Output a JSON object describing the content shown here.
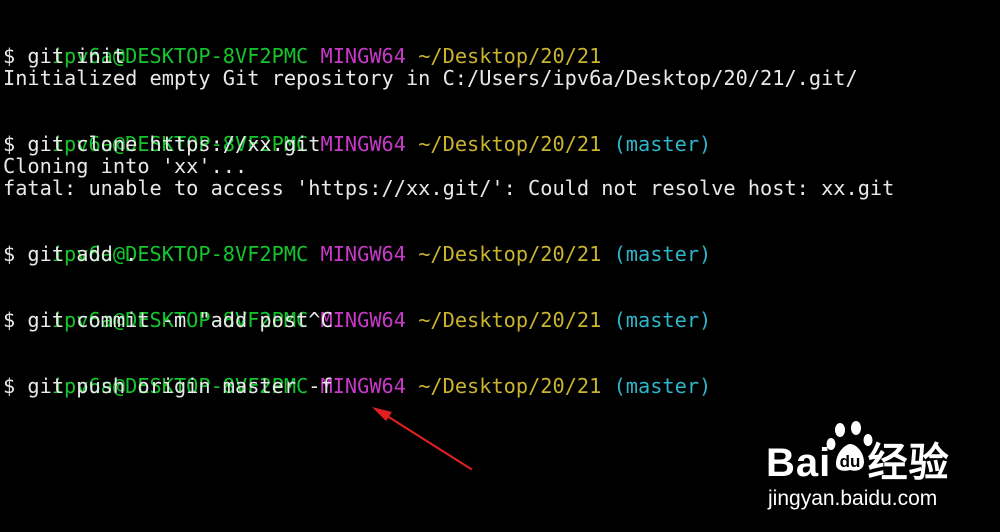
{
  "terminal": {
    "blocks": [
      {
        "prompt": {
          "user": "ipv6a@DESKTOP-8VF2PMC",
          "system": "MINGW64",
          "path": "~/Desktop/20/21",
          "branch": ""
        },
        "command": "$ git init",
        "output": [
          "Initialized empty Git repository in C:/Users/ipv6a/Desktop/20/21/.git/"
        ]
      },
      {
        "prompt": {
          "user": "ipv6a@DESKTOP-8VF2PMC",
          "system": "MINGW64",
          "path": "~/Desktop/20/21",
          "branch": "(master)"
        },
        "command": "$ git clone https://xx.git",
        "output": [
          "Cloning into 'xx'...",
          "fatal: unable to access 'https://xx.git/': Could not resolve host: xx.git"
        ]
      },
      {
        "prompt": {
          "user": "ipv6a@DESKTOP-8VF2PMC",
          "system": "MINGW64",
          "path": "~/Desktop/20/21",
          "branch": "(master)"
        },
        "command": "$ git add .",
        "output": []
      },
      {
        "prompt": {
          "user": "ipv6a@DESKTOP-8VF2PMC",
          "system": "MINGW64",
          "path": "~/Desktop/20/21",
          "branch": "(master)"
        },
        "command": "$ git commit -m \"add post^C",
        "output": []
      },
      {
        "prompt": {
          "user": "ipv6a@DESKTOP-8VF2PMC",
          "system": "MINGW64",
          "path": "~/Desktop/20/21",
          "branch": "(master)"
        },
        "command": "$ git push origin master -f",
        "output": []
      }
    ]
  },
  "colors": {
    "background": "#000000",
    "user": "#13c62c",
    "system": "#c839c8",
    "path": "#c9b32f",
    "branch": "#2fb5c9",
    "text": "#e8e8e8",
    "annotation_arrow": "#e02020"
  },
  "watermark": {
    "logo_text": "Bai   经验",
    "site": "jingyan.baidu.com",
    "icon": "baidu-paw-icon"
  }
}
